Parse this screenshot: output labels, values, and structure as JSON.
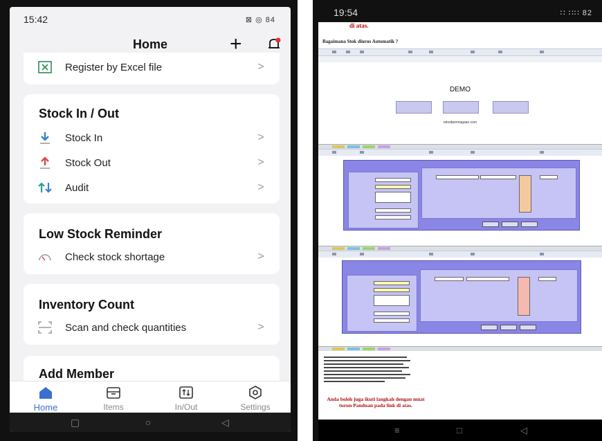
{
  "left": {
    "status": {
      "time": "15:42",
      "right_icons": "⊠ ◎ 84"
    },
    "header": {
      "title": "Home"
    },
    "register_row": {
      "label": "Register by Excel file"
    },
    "stock_card": {
      "title": "Stock In / Out",
      "items": [
        {
          "label": "Stock In"
        },
        {
          "label": "Stock Out"
        },
        {
          "label": "Audit"
        }
      ]
    },
    "low_stock_card": {
      "title": "Low Stock Reminder",
      "item": "Check stock shortage"
    },
    "inventory_card": {
      "title": "Inventory Count",
      "item": "Scan and check quantities"
    },
    "member_card": {
      "title": "Add Member"
    },
    "tabs": [
      {
        "label": "Home"
      },
      {
        "label": "Items"
      },
      {
        "label": "In/Out"
      },
      {
        "label": "Settings"
      }
    ],
    "colors": {
      "accent": "#3b6fd4",
      "stock_in": "#3b7fd4",
      "stock_out": "#e04848",
      "audit": "#2aa198"
    }
  },
  "right": {
    "status": {
      "time": "19:54",
      "right_icons": "∷ ∷∷ 82"
    },
    "doc": {
      "top_red_text": "di atas.",
      "question": "Bagaimana Stok diurus Automatik ?",
      "demo_title": "DEMO",
      "site": "rekodperniagaan.com",
      "bottom_red_text": "Anda boleh juga ikuti langkah dengan muat turun Panduan pada link di atas."
    }
  }
}
